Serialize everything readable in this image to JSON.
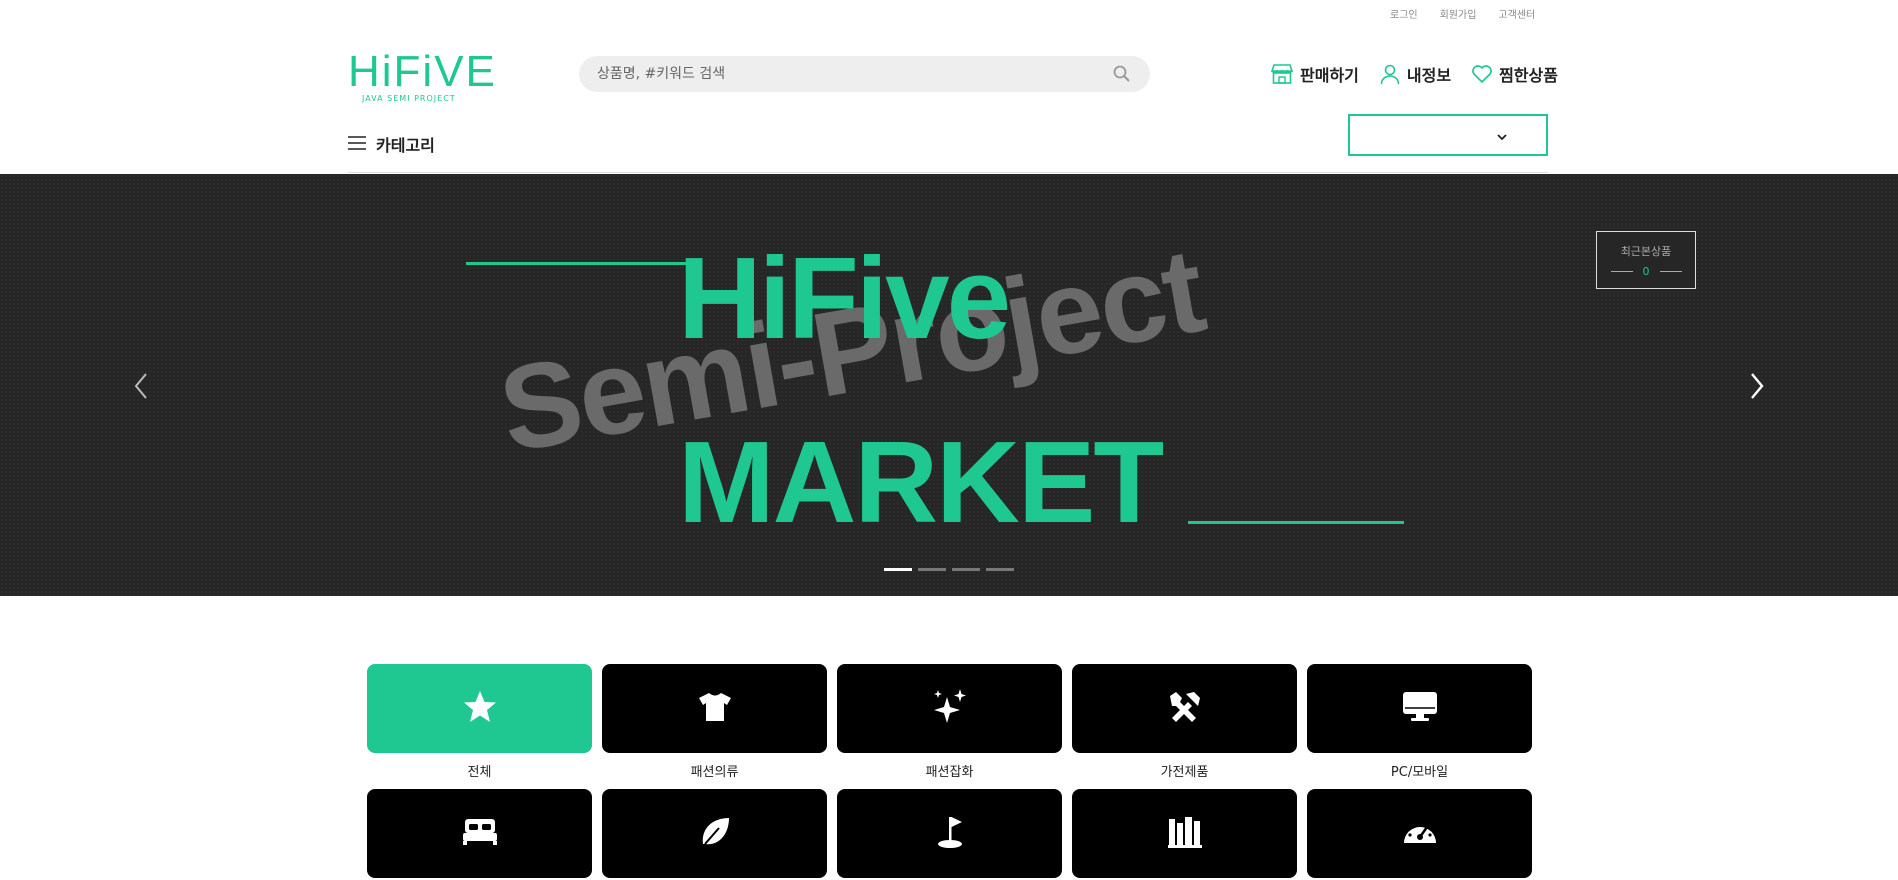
{
  "top_links": [
    "로그인",
    "회원가입",
    "고객센터"
  ],
  "logo": {
    "mark": "HiFiVE",
    "sub": "JAVA SEMI PROJECT"
  },
  "search": {
    "placeholder": "상품명, #키워드 검색"
  },
  "actions": {
    "sell": "판매하기",
    "my_info": "내정보",
    "wishlist": "찜한상품"
  },
  "category_button": "카테고리",
  "banner": {
    "title_top": "HiFive",
    "title_bottom": "MARKET",
    "watermark": "Semi-Project",
    "slides": 4,
    "active_slide": 1
  },
  "recent": {
    "title": "최근본상품",
    "count": "0"
  },
  "categories": [
    {
      "label": "전체",
      "icon": "star-icon",
      "active": true
    },
    {
      "label": "패션의류",
      "icon": "tshirt-icon",
      "active": false
    },
    {
      "label": "패션잡화",
      "icon": "sparkles-icon",
      "active": false
    },
    {
      "label": "가전제품",
      "icon": "tools-icon",
      "active": false
    },
    {
      "label": "PC/모바일",
      "icon": "desktop-icon",
      "active": false
    },
    {
      "label": "",
      "icon": "bed-icon",
      "active": false
    },
    {
      "label": "",
      "icon": "leaf-icon",
      "active": false
    },
    {
      "label": "",
      "icon": "golf-icon",
      "active": false
    },
    {
      "label": "",
      "icon": "books-icon",
      "active": false
    },
    {
      "label": "",
      "icon": "gauge-icon",
      "active": false
    }
  ],
  "colors": {
    "accent": "#1fc890",
    "banner_bg": "#262626",
    "tile_bg": "#000000"
  }
}
